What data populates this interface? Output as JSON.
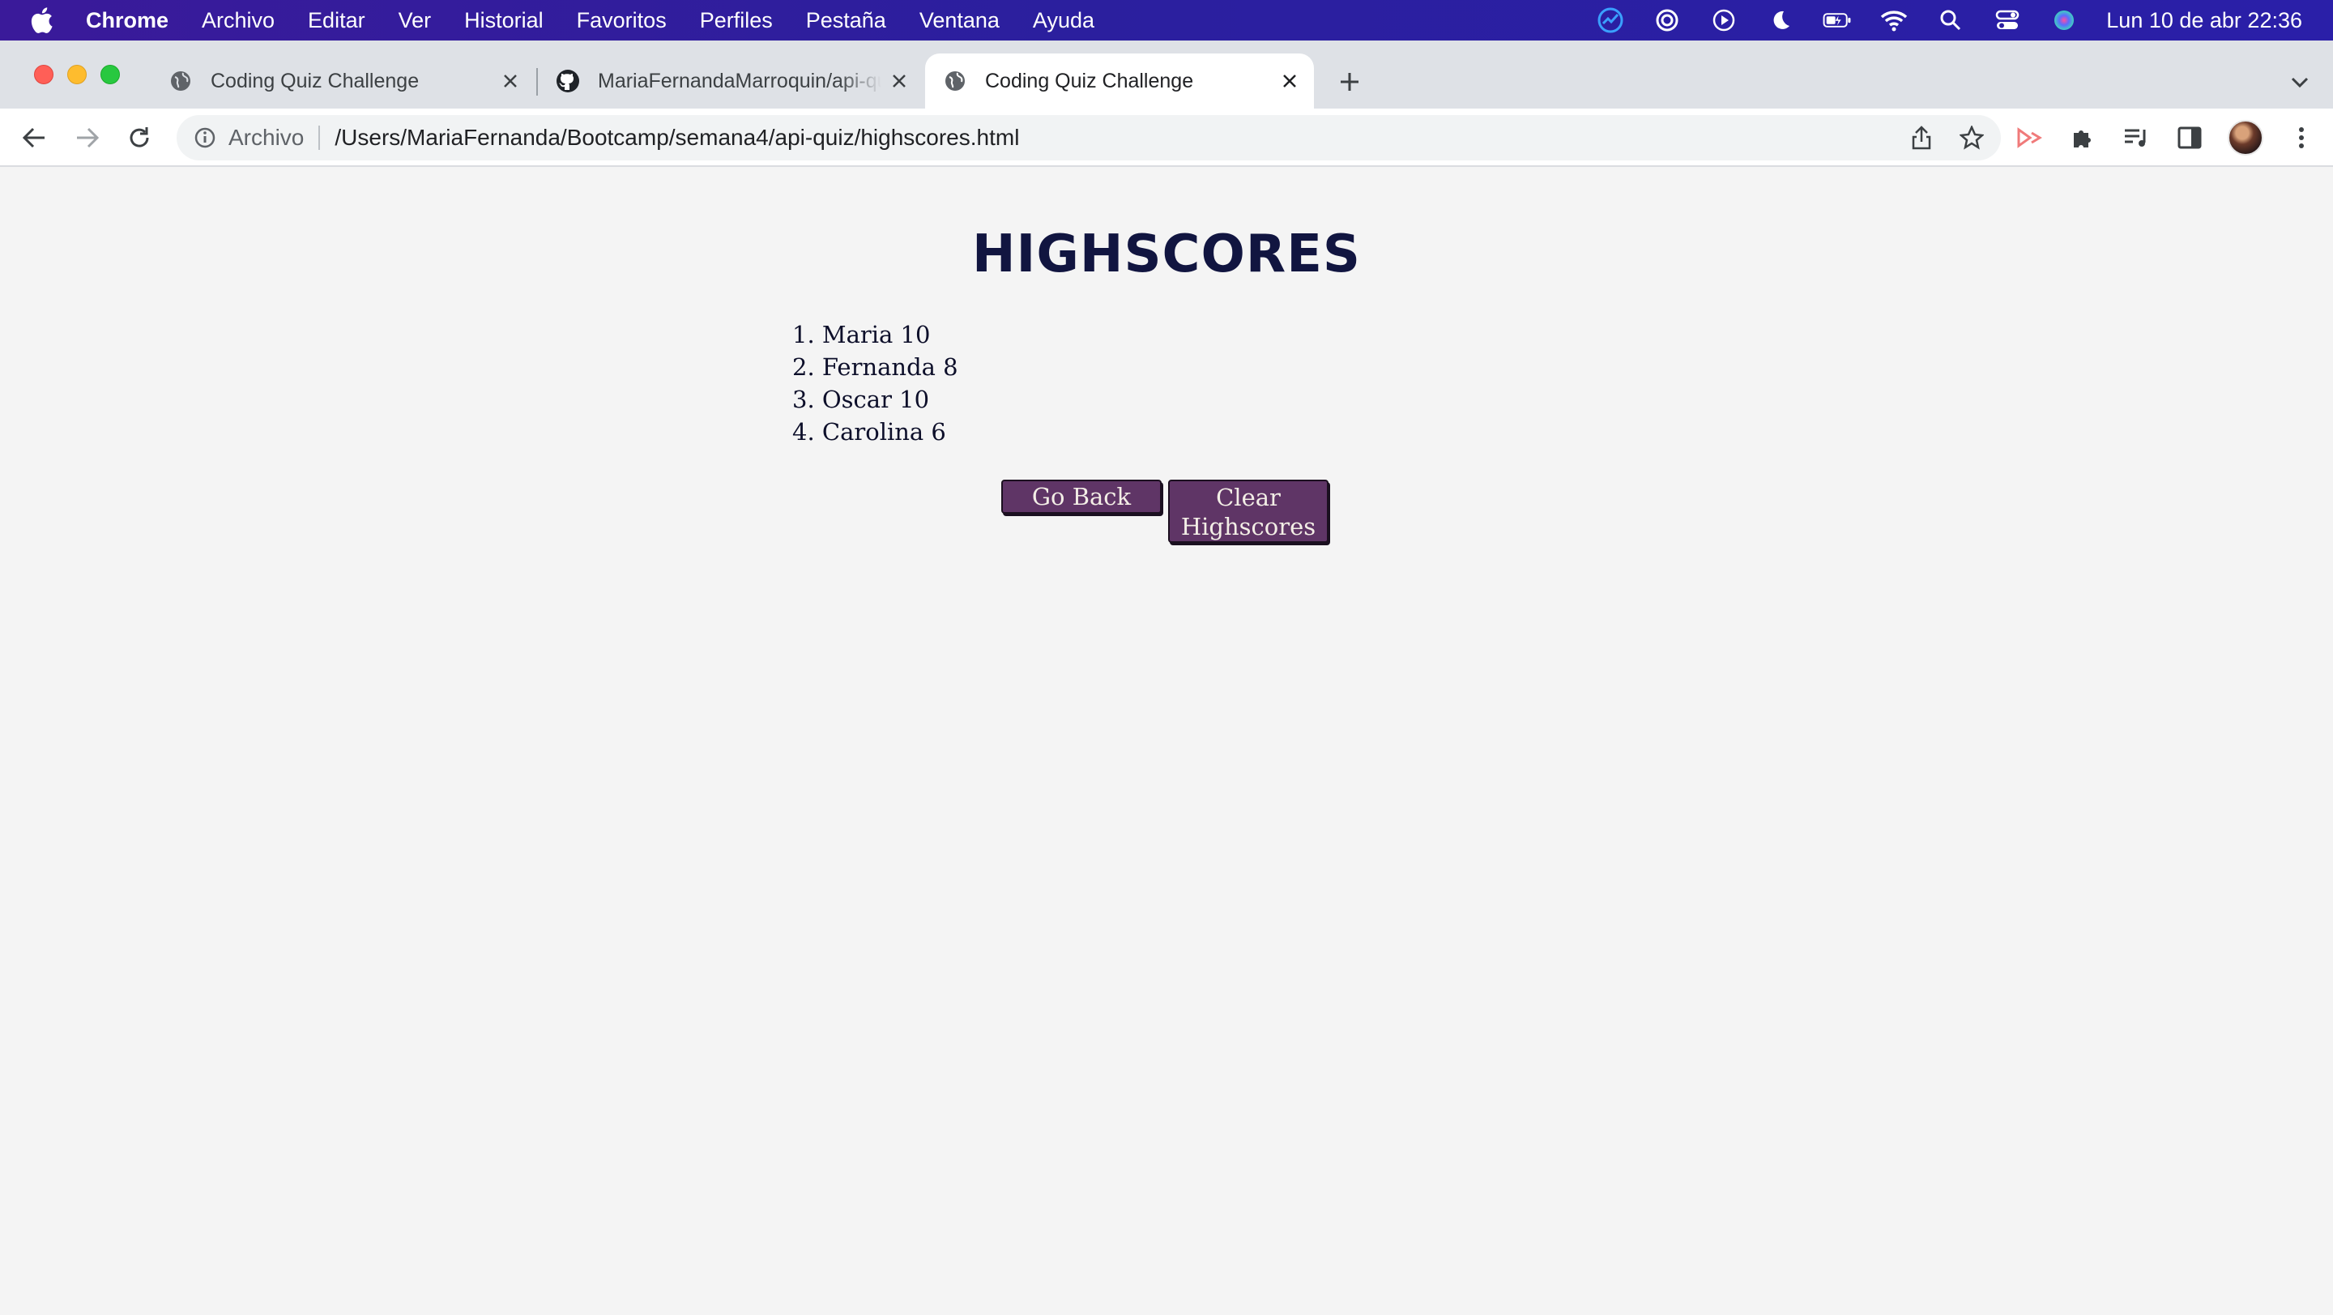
{
  "menubar": {
    "app_name": "Chrome",
    "items": [
      "Archivo",
      "Editar",
      "Ver",
      "Historial",
      "Favoritos",
      "Perfiles",
      "Pestaña",
      "Ventana",
      "Ayuda"
    ],
    "clock": "Lun 10 de abr  22:36"
  },
  "tabs": [
    {
      "title": "Coding Quiz Challenge",
      "active": false
    },
    {
      "title": "MariaFernandaMarroquin/api-quiz",
      "active": false
    },
    {
      "title": "Coding Quiz Challenge",
      "active": true
    }
  ],
  "toolbar": {
    "scheme_label": "Archivo",
    "url": "/Users/MariaFernanda/Bootcamp/semana4/api-quiz/highscores.html"
  },
  "page": {
    "title": "HIGHSCORES",
    "scores": [
      "1. Maria 10",
      "2. Fernanda 8",
      "3. Oscar 10",
      "4. Carolina 6"
    ],
    "go_back_label": "Go Back",
    "clear_label_line1": "Clear",
    "clear_label_line2": "Highscores"
  },
  "colors": {
    "menubar": "#2b1f9e",
    "button_bg": "#5f3566",
    "heading": "#111540",
    "page_bg": "#f4f4f4"
  }
}
